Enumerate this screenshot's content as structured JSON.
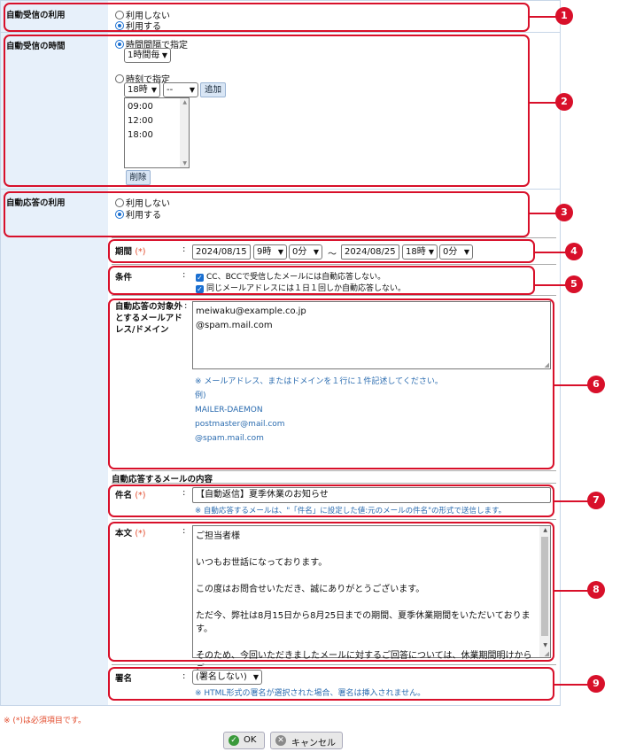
{
  "receive_use": {
    "label": "自動受信の利用",
    "options": [
      "利用しない",
      "利用する"
    ],
    "selected": 1
  },
  "receive_time": {
    "label": "自動受信の時間",
    "interval_option": "時間間隔で指定",
    "interval_value": "1時間毎",
    "time_option": "時刻で指定",
    "hour_value": "18時",
    "minute_value": "--",
    "add_button": "追加",
    "times": [
      "09:00",
      "12:00",
      "18:00"
    ],
    "delete_button": "削除"
  },
  "reply_use": {
    "label": "自動応答の利用",
    "options": [
      "利用しない",
      "利用する"
    ],
    "selected": 1
  },
  "period": {
    "label": "期間",
    "required": "(*)",
    "start_date": "2024/08/15",
    "start_hour": "9時",
    "start_min": "0分",
    "tilde": "～",
    "end_date": "2024/08/25",
    "end_hour": "18時",
    "end_min": "0分"
  },
  "conditions": {
    "label": "条件",
    "items": [
      "CC、BCCで受信したメールには自動応答しない。",
      "同じメールアドレスには１日１回しか自動応答しない。"
    ]
  },
  "exclusion": {
    "label_lines": [
      "自動応答の対象外",
      "とするメールアド",
      "レス/ドメイン"
    ],
    "lines": [
      "meiwaku@example.co.jp",
      "@spam.mail.com"
    ],
    "help": "※ メールアドレス、またはドメインを１行に１件記述してください。",
    "example_title": "例)",
    "examples": [
      "MAILER-DAEMON",
      "postmaster@mail.com",
      "@spam.mail.com"
    ]
  },
  "reply_section_title": "自動応答するメールの内容",
  "subject": {
    "label": "件名",
    "required": "(*)",
    "value": "【自動返信】夏季休業のお知らせ",
    "help": "※ 自動応答するメールは、\"「件名」に設定した値:元のメールの件名\"の形式で送信します。"
  },
  "body": {
    "label": "本文",
    "required": "(*)",
    "lines": [
      "ご担当者様",
      "いつもお世話になっております。",
      "この度はお問合せいただき、誠にありがとうございます。",
      "ただ今、弊社は8月15日から8月25日までの期間、夏季休業期間をいただいておりま",
      "す。",
      "そのため、今回いただきましたメールに対するご回答については、休業期間明けからご"
    ]
  },
  "signature": {
    "label": "署名",
    "value": "(署名しない)",
    "help": "※ HTML形式の署名が選択された場合、署名は挿入されません。"
  },
  "colon": ":",
  "required_note": "※ (*)は必須項目です。",
  "ok_button": "OK",
  "cancel_button": "キャンセル",
  "callouts": [
    "1",
    "2",
    "3",
    "4",
    "5",
    "6",
    "7",
    "8",
    "9"
  ],
  "colors": {
    "annotation_red": "#d8102a",
    "label_bg": "#e7f0fa",
    "link_blue": "#2b6cb0",
    "required_orange": "#e24a2b"
  }
}
